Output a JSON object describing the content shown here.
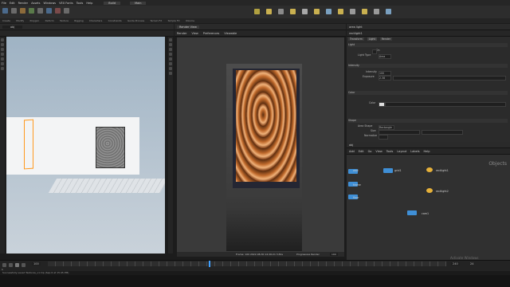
{
  "menu": {
    "items": [
      "File",
      "Edit",
      "Render",
      "Assets",
      "Windows",
      "VEX Fonts",
      "Tools",
      "Help"
    ],
    "desktop": "Build",
    "main": "Main"
  },
  "shelf": {
    "tabs": [
      "Create",
      "Modify",
      "Polygon",
      "Deform",
      "Texture",
      "Rigging",
      "Characters",
      "Constraints",
      "Guide Process",
      "Terrain FX",
      "Simple FX",
      "Volume"
    ]
  },
  "left_pane": {
    "path": "obj",
    "viewport_label": "Scene View"
  },
  "center_pane": {
    "tab": "Render View",
    "menu": [
      "Render",
      "View",
      "Preferences",
      "Viewable"
    ],
    "camera": "cam1",
    "status": "Frame: 100  2022-08-30 14:26:21  3.81s",
    "progressive": "Progressive Render",
    "zoom": "100"
  },
  "param_pane": {
    "title": "area light",
    "node": "rectlight1",
    "tabs": [
      "Transform",
      "Light",
      "Render"
    ],
    "sections": [
      "Light",
      "Intensity",
      "Color",
      "Shape"
    ],
    "rows": [
      {
        "label": "On",
        "value": ""
      },
      {
        "label": "Light Type",
        "value": "Area"
      },
      {
        "label": "Intensity",
        "value": "100"
      },
      {
        "label": "Exposure",
        "value": "2.38"
      },
      {
        "label": "Color",
        "value": ""
      },
      {
        "label": "Area Shape",
        "value": "Rectangle"
      },
      {
        "label": "Size",
        "value": "1"
      },
      {
        "label": "Normalize",
        "value": ""
      }
    ]
  },
  "network": {
    "tabs": [
      "obj"
    ],
    "menu": [
      "Add",
      "Edit",
      "Go",
      "View",
      "Tools",
      "Layout",
      "Labels",
      "Help"
    ],
    "title": "Objects",
    "nodes": [
      {
        "name": "wall",
        "color": "#3f8fd6"
      },
      {
        "name": "grid1",
        "color": "#3f8fd6"
      },
      {
        "name": "rectlight1",
        "color": "#e6b13a"
      },
      {
        "name": "frame",
        "color": "#3f8fd6"
      },
      {
        "name": "rectlight2",
        "color": "#e6b13a"
      },
      {
        "name": "floor",
        "color": "#3f8fd6"
      },
      {
        "name": "cam1",
        "color": "#3f8fd6"
      }
    ]
  },
  "timeline": {
    "frame": "100",
    "start": "1",
    "end": "240",
    "fps": "24"
  },
  "statusbar": {
    "text": "Successfully saved Textures_v1.hip (Sep 6 at 15:45 PM)",
    "activate": "Activate Windows"
  },
  "colors": {
    "accent_orange": "#ff9a1f",
    "node_blue": "#3f8fd6",
    "node_yellow": "#e6b13a"
  }
}
